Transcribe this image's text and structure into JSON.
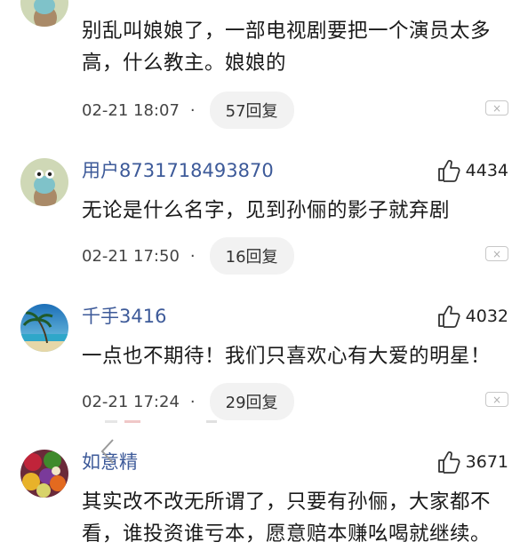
{
  "comments": [
    {
      "user": "",
      "likes": "",
      "text": "别乱叫娘娘了，一部电视剧要把一个演员太多高，什么教主。娘娘的",
      "time": "02-21 18:07",
      "replies": "57回复",
      "avatar": "cartoon-character"
    },
    {
      "user": "用户8731718493870",
      "likes": "4434",
      "text": "无论是什么名字，见到孙俪的影子就弃剧",
      "time": "02-21 17:50",
      "replies": "16回复",
      "avatar": "cartoon-character"
    },
    {
      "user": "千手3416",
      "likes": "4032",
      "text": "一点也不期待！我们只喜欢心有大爱的明星！",
      "time": "02-21 17:24",
      "replies": "29回复",
      "avatar": "beach-palm"
    },
    {
      "user": "如意精",
      "likes": "3671",
      "text": "其实改不改无所谓了，只要有孙俪，大家都不看，谁投资谁亏本，愿意赔本赚吆喝就继续。",
      "time": "",
      "replies": "",
      "avatar": "fruits"
    }
  ],
  "meta_separator": "·",
  "close_glyph": "×",
  "colors": {
    "username": "#3d5a99",
    "reply_bg": "#f2f2f2"
  }
}
